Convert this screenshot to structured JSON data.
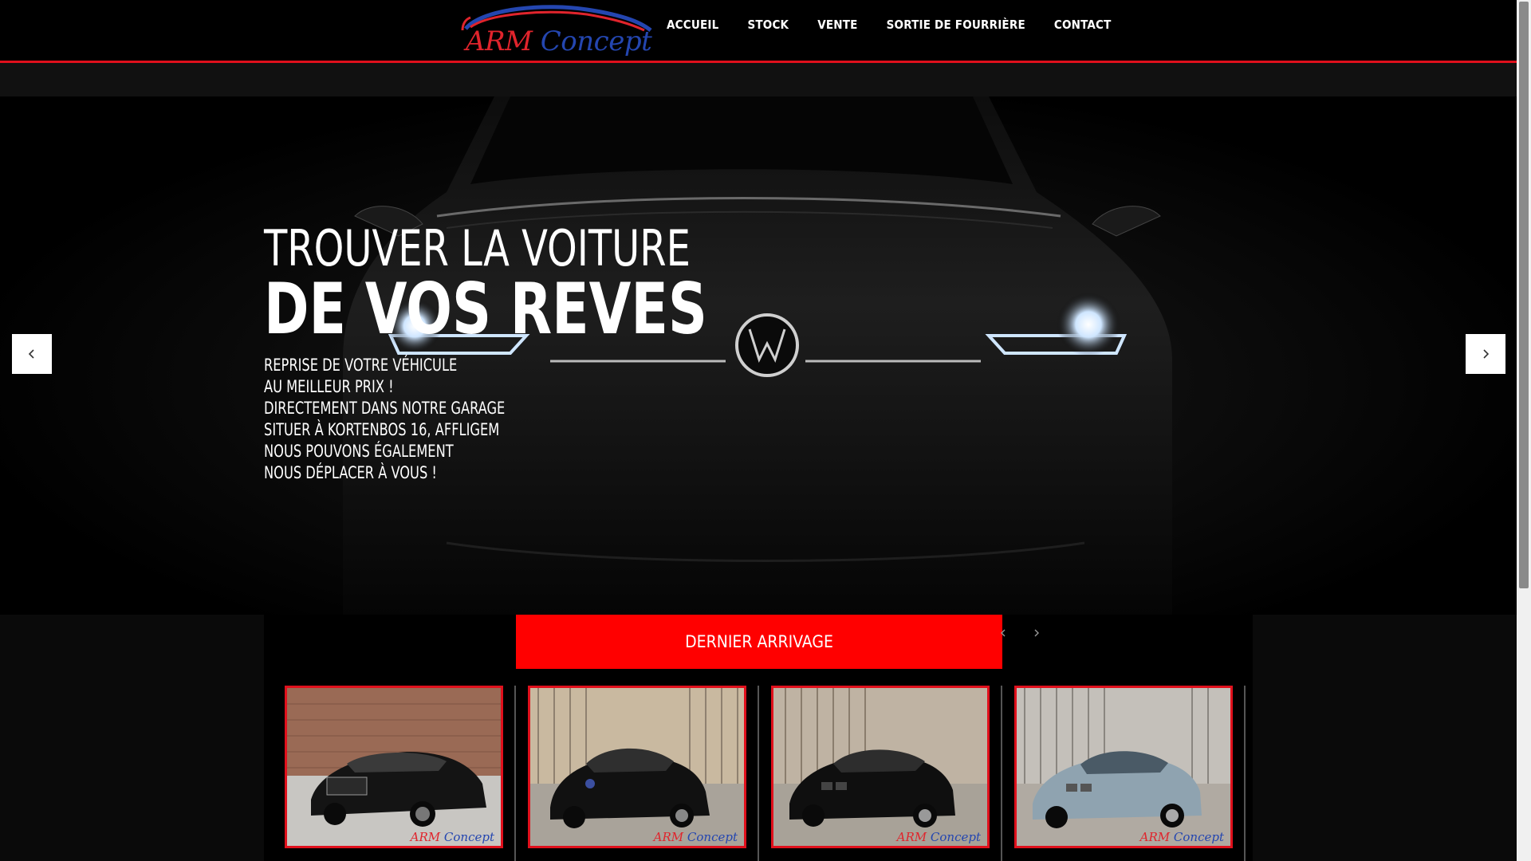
{
  "brand": {
    "name_part1": "ARM",
    "name_part2": "Concept"
  },
  "nav": {
    "items": [
      "ACCUEIL",
      "STOCK",
      "VENTE",
      "SORTIE DE FOURRIÈRE",
      "CONTACT"
    ]
  },
  "hero": {
    "line1": "TROUVER LA VOITURE",
    "line2": "DE VOS REVES",
    "sub_lines": [
      "REPRISE DE VOTRE VÉHICULE",
      "AU MEILLEUR PRIX !",
      "DIRECTEMENT DANS NOTRE GARAGE",
      "SITUER À KORTENBOS 16, AFFLIGEM",
      "NOUS POUVONS ÉGALEMENT",
      "NOUS DÉPLACER À VOUS !"
    ]
  },
  "arrivals": {
    "title": "DERNIER ARRIVAGE",
    "cards": [
      {
        "name": "black-sedan",
        "watermark1": "ARM",
        "watermark2": "Concept"
      },
      {
        "name": "black-hatchback-vw",
        "watermark1": "ARM",
        "watermark2": "Concept"
      },
      {
        "name": "black-hatchback-bmw",
        "watermark1": "ARM",
        "watermark2": "Concept"
      },
      {
        "name": "silver-sedan-bmw",
        "watermark1": "ARM",
        "watermark2": "Concept"
      }
    ]
  },
  "colors": {
    "accent": "#ff0000",
    "header_line": "#e0101c",
    "logo_red": "#e0242c",
    "logo_blue": "#2446b0"
  }
}
